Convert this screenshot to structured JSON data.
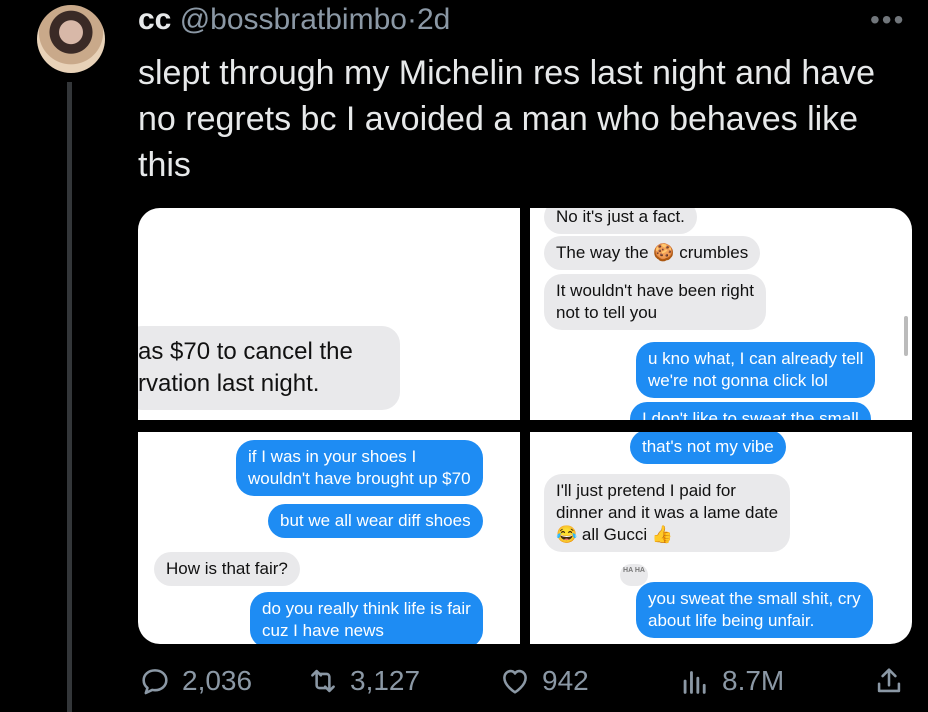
{
  "tweet": {
    "display_name": "cc",
    "handle": "@bossbratbimbo",
    "separator": "·",
    "age": "2d",
    "text": "slept through my Michelin res last night and have no regrets bc I avoided a man who behaves like this"
  },
  "media": {
    "panel1": {
      "bubble_line1": "as $70 to cancel the",
      "bubble_line2": "rvation last night."
    },
    "panel2": {
      "msg1": "No it's just a fact.",
      "msg2_before": "The way the",
      "msg2_after": "crumbles",
      "msg3_line1": "It wouldn't have been right",
      "msg3_line2": "not to tell you",
      "msg4_line1": "u kno what, I can already tell",
      "msg4_line2": "we're not gonna click lol",
      "msg5_partial": "I don't like to sweat the small"
    },
    "panel3": {
      "msg1_line1": "if I was in your shoes I",
      "msg1_line2": "wouldn't have brought up $70",
      "msg2": "but we all wear diff shoes",
      "msg3": "How is that fair?",
      "msg4_line1": "do you really think life is fair",
      "msg4_line2": "cuz I have news"
    },
    "panel4": {
      "msg1": "that's not my vibe",
      "msg2_line1": "I'll just pretend I paid for",
      "msg2_line2": "dinner and it was a lame date",
      "msg2_line3": "all Gucci",
      "reaction_label": "HA HA",
      "msg3_line1": "you sweat the small shit, cry",
      "msg3_line2": "about life being unfair."
    }
  },
  "actions": {
    "replies": "2,036",
    "retweets": "3,127",
    "likes": "942",
    "views": "8.7M"
  },
  "colors": {
    "background": "#000000",
    "text_primary": "#e7e9ea",
    "text_secondary": "#8b98a5",
    "imessage_blue": "#1e8cf3",
    "imessage_gray": "#e9e9eb"
  },
  "icons": [
    "more-icon",
    "reply-icon",
    "retweet-icon",
    "like-icon",
    "views-icon",
    "share-icon",
    "cookie-emoji",
    "laugh-emoji",
    "thumbs-up-emoji"
  ]
}
